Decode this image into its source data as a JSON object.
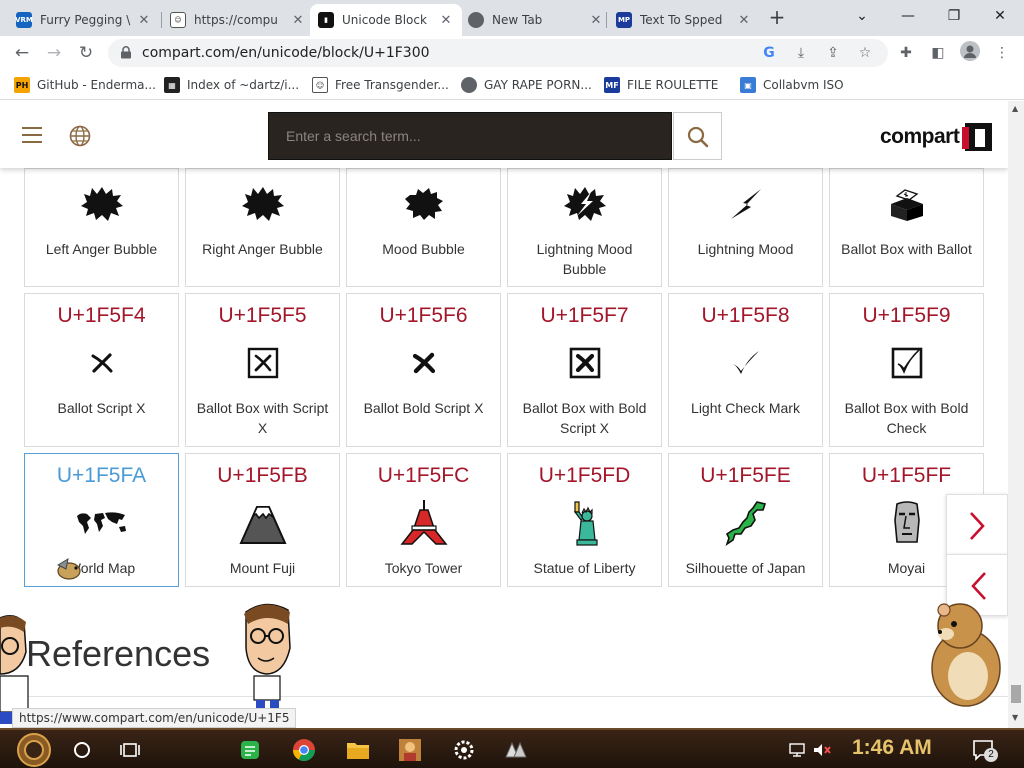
{
  "browser": {
    "tabs": [
      {
        "title": "Furry Pegging \\",
        "favicon": "vrm-icon"
      },
      {
        "title": "https://compu",
        "favicon": "mask-icon"
      },
      {
        "title": "Unicode Block",
        "favicon": "compart-icon"
      },
      {
        "title": "New Tab",
        "favicon": "chrome-icon"
      },
      {
        "title": "Text To Spped",
        "favicon": "tts-icon"
      }
    ],
    "active_tab": 2,
    "url": "compart.com/en/unicode/block/U+1F300",
    "bookmarks": [
      {
        "label": "GitHub - Enderma...",
        "icon": "ph-icon"
      },
      {
        "label": "Index of ~dartz/i...",
        "icon": "qr-icon"
      },
      {
        "label": "Free Transgender...",
        "icon": "mask-icon"
      },
      {
        "label": "GAY RAPE PORN...",
        "icon": "globe-icon"
      },
      {
        "label": "FILE ROULETTE",
        "icon": "file-icon"
      },
      {
        "label": "Collabvm ISO",
        "icon": "vm-icon"
      }
    ]
  },
  "site": {
    "search_placeholder": "Enter a search term...",
    "logo_text": "compart"
  },
  "grid": {
    "top_row": [
      {
        "name": "Left Anger Bubble",
        "glyph": "anger-bubble-icon"
      },
      {
        "name": "Right Anger Bubble",
        "glyph": "anger-bubble-icon"
      },
      {
        "name": "Mood Bubble",
        "glyph": "mood-bubble-icon"
      },
      {
        "name": "Lightning Mood Bubble",
        "glyph": "lightning-bubble-icon"
      },
      {
        "name": "Lightning Mood",
        "glyph": "lightning-icon"
      },
      {
        "name": "Ballot Box with Ballot",
        "glyph": "ballot-box-icon"
      }
    ],
    "row2": [
      {
        "code": "U+1F5F4",
        "name": "Ballot Script X",
        "glyph": "script-x-icon"
      },
      {
        "code": "U+1F5F5",
        "name": "Ballot Box with Script X",
        "glyph": "box-x-icon"
      },
      {
        "code": "U+1F5F6",
        "name": "Ballot Bold Script X",
        "glyph": "bold-x-icon"
      },
      {
        "code": "U+1F5F7",
        "name": "Ballot Box with Bold Script X",
        "glyph": "box-bold-x-icon"
      },
      {
        "code": "U+1F5F8",
        "name": "Light Check Mark",
        "glyph": "check-icon"
      },
      {
        "code": "U+1F5F9",
        "name": "Ballot Box with Bold Check",
        "glyph": "box-check-icon"
      }
    ],
    "row3": [
      {
        "code": "U+1F5FA",
        "name": "World Map",
        "glyph": "world-map-icon"
      },
      {
        "code": "U+1F5FB",
        "name": "Mount Fuji",
        "glyph": "mount-fuji-icon"
      },
      {
        "code": "U+1F5FC",
        "name": "Tokyo Tower",
        "glyph": "tokyo-tower-icon"
      },
      {
        "code": "U+1F5FD",
        "name": "Statue of Liberty",
        "glyph": "statue-of-liberty-icon"
      },
      {
        "code": "U+1F5FE",
        "name": "Silhouette of Japan",
        "glyph": "japan-icon"
      },
      {
        "code": "U+1F5FF",
        "name": "Moyai",
        "glyph": "moyai-icon"
      }
    ]
  },
  "references_heading": "References",
  "status_url": "https://www.compart.com/en/unicode/U+1F5",
  "taskbar": {
    "clock": "1:46 AM",
    "notification_count": "2"
  },
  "colors": {
    "code_red": "#a4162a",
    "code_blue": "#4a9bd6",
    "search_bg": "#2a2420",
    "brand_red": "#c8102e"
  }
}
